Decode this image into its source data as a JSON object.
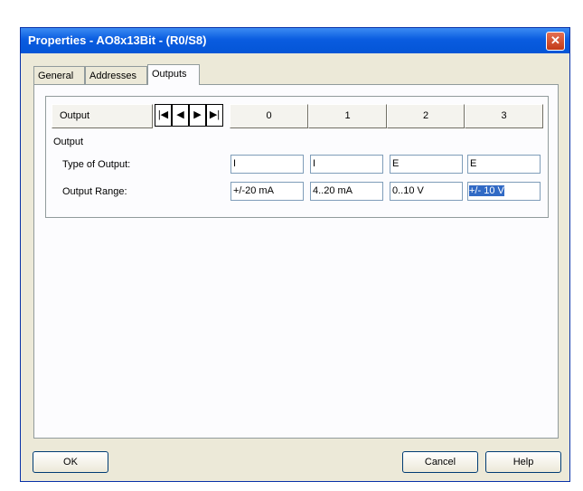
{
  "window": {
    "title": "Properties - AO8x13Bit - (R0/S8)",
    "close_glyph": "✕"
  },
  "tabs": [
    {
      "label": "General"
    },
    {
      "label": "Addresses"
    },
    {
      "label": "Outputs"
    }
  ],
  "active_tab": "Outputs",
  "header": {
    "output_label": "Output",
    "nav": {
      "first": "|◀",
      "prev": "◀",
      "next": "▶",
      "last": "▶|"
    },
    "columns": [
      "0",
      "1",
      "2",
      "3"
    ]
  },
  "section": {
    "title": "Output",
    "rows": [
      {
        "label": "Type of Output:",
        "values": [
          "I",
          "I",
          "E",
          "E"
        ]
      },
      {
        "label": "Output Range:",
        "values": [
          "+/-20 mA",
          "4..20 mA",
          "0..10 V",
          "+/- 10 V"
        ]
      }
    ]
  },
  "buttons": {
    "ok": "OK",
    "cancel": "Cancel",
    "help": "Help"
  },
  "colors": {
    "title_bar": "#0a5ce0",
    "selection": "#316ac5",
    "dialog_bg": "#ece9d8"
  }
}
